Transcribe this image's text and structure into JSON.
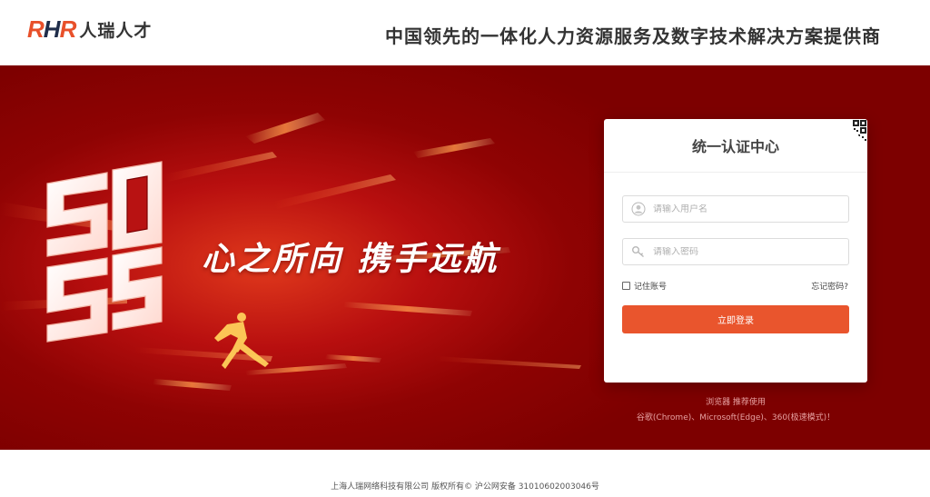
{
  "header": {
    "logo_text": "人瑞人才",
    "slogan": "中国领先的一体化人力资源服务及数字技术解决方案提供商"
  },
  "banner": {
    "slogan": "心之所向 携手远航"
  },
  "login": {
    "title": "统一认证中心",
    "username_placeholder": "请输入用户名",
    "password_placeholder": "请输入密码",
    "remember_label": "记住账号",
    "forgot_label": "忘记密码?",
    "submit_label": "立即登录"
  },
  "browsers": {
    "title": "浏览器 推荐使用",
    "list": "谷歌(Chrome)、Microsoft(Edge)、360(极速模式)！"
  },
  "footer": {
    "copyright": "上海人瑞网络科技有限公司   版权所有©   沪公网安备 31010602003046号"
  },
  "colors": {
    "accent": "#e9552d",
    "banner_red": "#8f0303",
    "logo_navy": "#1f2d4a"
  }
}
